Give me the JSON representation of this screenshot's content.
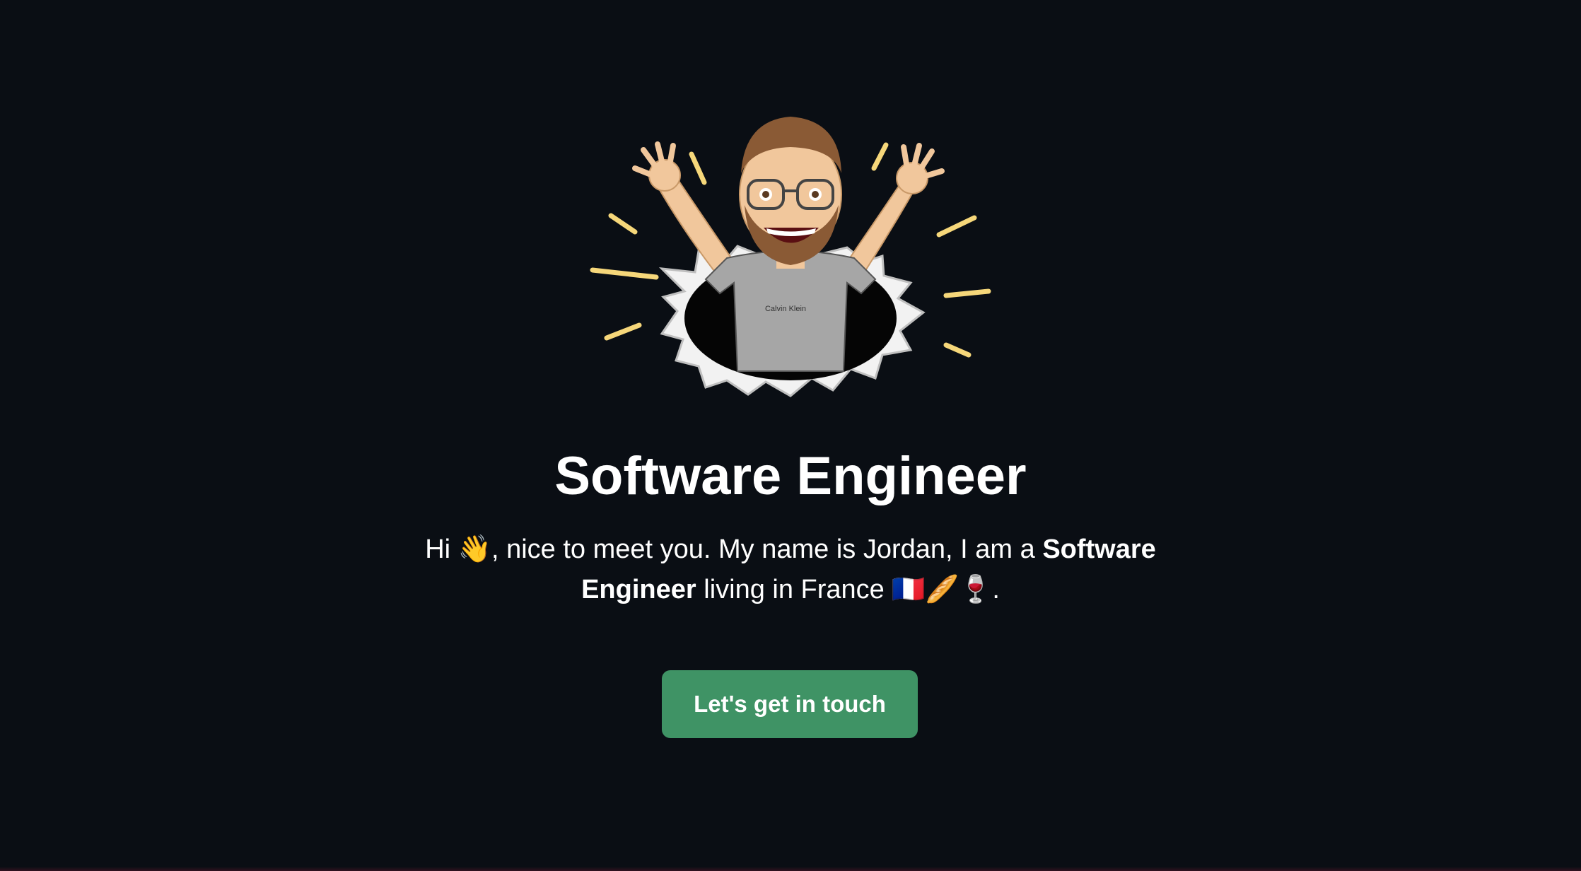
{
  "hero": {
    "avatar_shirt_text": "Calvin Klein",
    "title": "Software Engineer",
    "intro": {
      "greeting": "Hi",
      "wave_emoji": "👋",
      "part1": ", nice to meet you. My name is Jordan, I am a ",
      "bold": "Software Engineer",
      "part2": " living in France ",
      "flag_emoji": "🇫🇷",
      "bread_emoji": "🥖",
      "wine_emoji": "🍷",
      "end": "."
    },
    "cta_label": "Let's get in touch"
  },
  "colors": {
    "background": "#0a0e14",
    "cta": "#3f9365",
    "text": "#ffffff",
    "burst": "#f6d77a"
  },
  "icons": {
    "avatar": "memoji-avatar-bursting-through-paper"
  }
}
